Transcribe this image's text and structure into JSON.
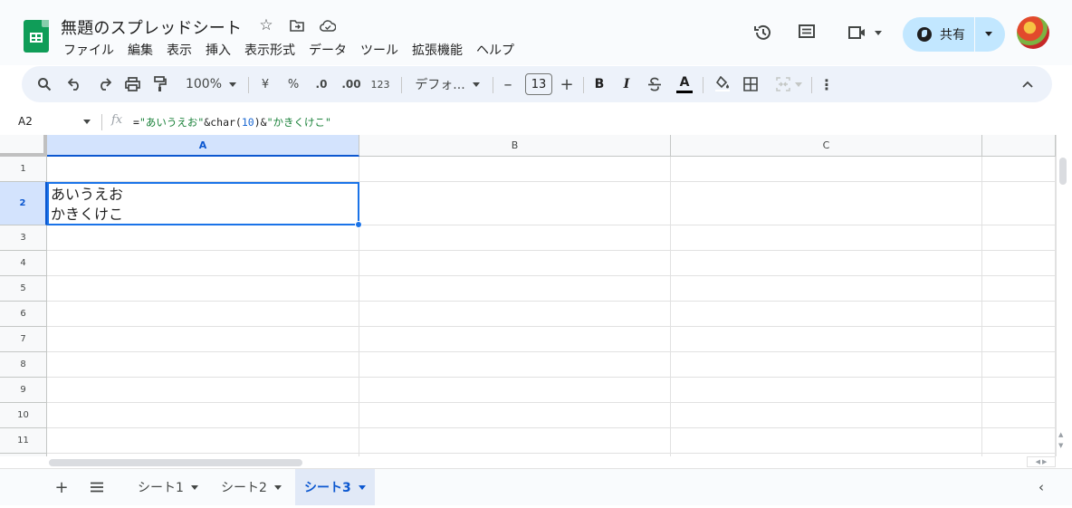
{
  "header": {
    "title": "無題のスプレッドシート",
    "menus": [
      "ファイル",
      "編集",
      "表示",
      "挿入",
      "表示形式",
      "データ",
      "ツール",
      "拡張機能",
      "ヘルプ"
    ],
    "share_label": "共有"
  },
  "toolbar": {
    "zoom": "100%",
    "currency": "¥",
    "percent": "%",
    "decrease_decimal": ".0",
    "increase_decimal": ".00",
    "more_formats": "123",
    "font": "デフォ...",
    "font_size": "13",
    "bold": "B",
    "italic": "I",
    "text_color": "A"
  },
  "formula_bar": {
    "cell_ref": "A2",
    "fx": "fx",
    "formula_parts": {
      "p1": "=",
      "p2": "\"あいうえお\"",
      "p3": "&char(",
      "p4": "10",
      "p5": ")&",
      "p6": "\"かきくけこ\""
    }
  },
  "grid": {
    "columns": [
      "A",
      "B",
      "C"
    ],
    "rows": [
      "1",
      "2",
      "3",
      "4",
      "5",
      "6",
      "7",
      "8",
      "9",
      "10",
      "11"
    ],
    "selected_cell": "A2",
    "cell_A2": "あいうえお\nかきくけこ"
  },
  "sheets": {
    "tabs": [
      "シート1",
      "シート2",
      "シート3"
    ],
    "active": "シート3"
  },
  "colors": {
    "accent": "#0b57d0",
    "selection": "#1a73e8",
    "share_bg": "#c2e7ff",
    "logo": "#0f9d58"
  }
}
